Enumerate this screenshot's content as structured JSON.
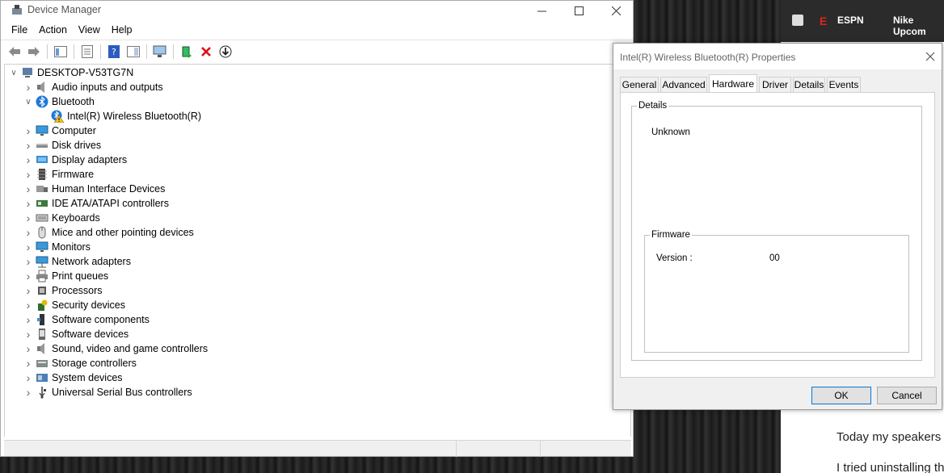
{
  "device_manager": {
    "title": "Device Manager",
    "menu": [
      "File",
      "Action",
      "View",
      "Help"
    ],
    "root": "DESKTOP-V53TG7N",
    "tree": [
      {
        "label": "Audio inputs and outputs",
        "icon": "speaker-icon",
        "depth": 1,
        "state": "collapsed"
      },
      {
        "label": "Bluetooth",
        "icon": "bluetooth-icon",
        "depth": 1,
        "state": "expanded"
      },
      {
        "label": "Intel(R) Wireless Bluetooth(R)",
        "icon": "bluetooth-warning-icon",
        "depth": 2,
        "state": "leaf"
      },
      {
        "label": "Computer",
        "icon": "monitor-icon",
        "depth": 1,
        "state": "collapsed"
      },
      {
        "label": "Disk drives",
        "icon": "disk-icon",
        "depth": 1,
        "state": "collapsed"
      },
      {
        "label": "Display adapters",
        "icon": "display-adapter-icon",
        "depth": 1,
        "state": "collapsed"
      },
      {
        "label": "Firmware",
        "icon": "chip-icon",
        "depth": 1,
        "state": "collapsed"
      },
      {
        "label": "Human Interface Devices",
        "icon": "hid-icon",
        "depth": 1,
        "state": "collapsed"
      },
      {
        "label": "IDE ATA/ATAPI controllers",
        "icon": "controller-icon",
        "depth": 1,
        "state": "collapsed"
      },
      {
        "label": "Keyboards",
        "icon": "keyboard-icon",
        "depth": 1,
        "state": "collapsed"
      },
      {
        "label": "Mice and other pointing devices",
        "icon": "mouse-icon",
        "depth": 1,
        "state": "collapsed"
      },
      {
        "label": "Monitors",
        "icon": "monitor-icon",
        "depth": 1,
        "state": "collapsed"
      },
      {
        "label": "Network adapters",
        "icon": "network-icon",
        "depth": 1,
        "state": "collapsed"
      },
      {
        "label": "Print queues",
        "icon": "printer-icon",
        "depth": 1,
        "state": "collapsed"
      },
      {
        "label": "Processors",
        "icon": "processor-icon",
        "depth": 1,
        "state": "collapsed"
      },
      {
        "label": "Security devices",
        "icon": "security-icon",
        "depth": 1,
        "state": "collapsed"
      },
      {
        "label": "Software components",
        "icon": "software-component-icon",
        "depth": 1,
        "state": "collapsed"
      },
      {
        "label": "Software devices",
        "icon": "software-device-icon",
        "depth": 1,
        "state": "collapsed"
      },
      {
        "label": "Sound, video and game controllers",
        "icon": "speaker-icon",
        "depth": 1,
        "state": "collapsed"
      },
      {
        "label": "Storage controllers",
        "icon": "storage-icon",
        "depth": 1,
        "state": "collapsed"
      },
      {
        "label": "System devices",
        "icon": "system-icon",
        "depth": 1,
        "state": "collapsed"
      },
      {
        "label": "Universal Serial Bus controllers",
        "icon": "usb-icon",
        "depth": 1,
        "state": "collapsed"
      }
    ]
  },
  "properties": {
    "title": "Intel(R) Wireless Bluetooth(R) Properties",
    "tabs": [
      "General",
      "Advanced",
      "Hardware",
      "Driver",
      "Details",
      "Events"
    ],
    "active_tab": "Hardware",
    "details_legend": "Details",
    "details_value": "Unknown",
    "firmware_legend": "Firmware",
    "version_label": "Version :",
    "version_value": "00",
    "ok_label": "OK",
    "cancel_label": "Cancel"
  },
  "browser": {
    "tab_espn": "ESPN",
    "tab_nike": "Nike Upcom",
    "article_line1": "Today my speakers w",
    "article_line2": "I tried uninstalling th"
  }
}
